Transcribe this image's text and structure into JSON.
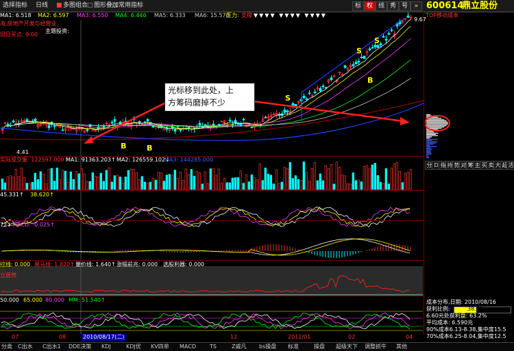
{
  "toolbar": {
    "buttons": [
      "选择指标",
      "日线",
      "多图组合",
      "图形叠加",
      "常用指标"
    ],
    "right_buttons": [
      "标",
      "权",
      "线",
      "秀",
      "号"
    ]
  },
  "ma_line": {
    "ma1": "MA1: 6.518",
    "ma2": "MA2: 6.597",
    "ma3": "MA3: 6.550",
    "ma4": "MA4: 6.446",
    "ma5": "MA5: 6.333",
    "ma6": "MA6: 15.570",
    "pressure": "压力:",
    "pressure_tag": "支撑"
  },
  "stock": {
    "code": "600614",
    "name": "鼎立股份",
    "sector": "海,房地产开发与经营业",
    "buy_point": "旧日买点: 0.00",
    "theme": "主题投资:",
    "cost_label": "TOP移动成本"
  },
  "price_labels": {
    "high": "9.67",
    "low": "4.41"
  },
  "signals": {
    "sell": "S",
    "buy": "B"
  },
  "callout": {
    "line1": "光标移到此处，上",
    "line2": "方筹码磨掉不少"
  },
  "vol_line": {
    "title": "实际成交量: 122597.000↑",
    "ma1": "MA1: 91363.203↑",
    "ma2": "MA2: 126559.102↓",
    "ma3": "MA3: 144285.000"
  },
  "kdj_line": {
    "a": "45.331↑",
    "b": "38.620↑"
  },
  "macd_line": {
    "a": "72↓",
    "b": "MACD: -0.025↑"
  },
  "sub4_line": {
    "a": "拉线: 0.000",
    "b": "黑马线: 1.820↑",
    "c": "量价线: 1.640↑",
    "d": "涨幅前兆: 0.000",
    "e": "选股利器: 0.000",
    "tag": "立居然"
  },
  "sub5_line": {
    "a": "50.000",
    "b": "65.000",
    "c": "80.000",
    "d": "MM: 51.540↑"
  },
  "x_axis": {
    "t1": "07",
    "t2": "08",
    "t3": "2010/08/17(二)",
    "t4": "12",
    "t5": "2011/01",
    "t6": "02",
    "t7": "04"
  },
  "indicator_tabs": [
    "分",
    "D",
    "指",
    "持",
    "势",
    "对",
    "筹",
    "主",
    "买",
    "卖",
    "大",
    "超",
    "活"
  ],
  "chip_info": {
    "title": "成本分布,日期: 2010/08/16",
    "profit_label": "获利比例:",
    "profit_value": "38.7%",
    "profit_at": "6.60元处获利盘: 63.2%",
    "avg_cost": "平均成本: 6.590元",
    "c90": "90%成本6.13-8.38,集中度15.5",
    "c70": "70%成本6.25-8.04,集中度12.5"
  },
  "bottom_tabs": [
    "分类",
    "C出水",
    "C出水1",
    "DDE决策",
    "KDJ",
    "KDJ优",
    "KV四单",
    "MACD",
    "TS",
    "Z威凡",
    "bs操盘",
    "标准",
    "操盘",
    "超级天下",
    "调整抓牛",
    "其他"
  ],
  "colors": {
    "up": "#ff3030",
    "down": "#00ffff",
    "accent": "#ffff00",
    "panel_border": "#7a0000"
  }
}
